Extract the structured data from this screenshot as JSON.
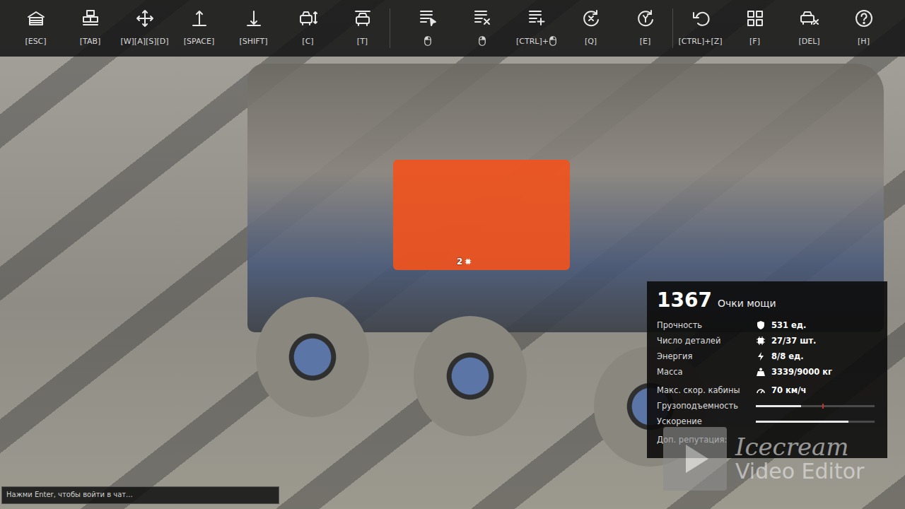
{
  "toolbar": {
    "items": [
      {
        "key": "[ESC]",
        "kind": "key"
      },
      {
        "key": "[TAB]",
        "kind": "key"
      },
      {
        "key": "[W][A][S][D]",
        "kind": "key"
      },
      {
        "key": "[SPACE]",
        "kind": "key"
      },
      {
        "key": "[SHIFT]",
        "kind": "key"
      },
      {
        "key": "[C]",
        "kind": "key"
      },
      {
        "key": "[T]",
        "kind": "key"
      },
      {
        "kind": "mouse",
        "button": "left"
      },
      {
        "kind": "mouse",
        "button": "right"
      },
      {
        "key": "[CTRL]+",
        "kind": "key-mouse",
        "button": "left"
      },
      {
        "key": "[Q]",
        "kind": "key"
      },
      {
        "key": "[E]",
        "kind": "key"
      },
      {
        "key": "[CTRL]+[Z]",
        "kind": "key"
      },
      {
        "key": "[F]",
        "kind": "key"
      },
      {
        "key": "[DEL]",
        "kind": "key"
      },
      {
        "key": "[H]",
        "kind": "key"
      }
    ]
  },
  "scene": {
    "part_count": "2"
  },
  "stats": {
    "power": "1367",
    "power_label": "Очки мощи",
    "rows": [
      {
        "label": "Прочность",
        "kind": "value",
        "value": "531 ед."
      },
      {
        "label": "Число деталей",
        "kind": "value",
        "value": "27/37 шт."
      },
      {
        "label": "Энергия",
        "kind": "value",
        "value": "8/8 ед."
      },
      {
        "label": "Масса",
        "kind": "value",
        "value": "3339/9000 кг"
      },
      {
        "label": "Макс. скор. кабины",
        "kind": "value",
        "value": "70 км/ч"
      },
      {
        "label": "Грузоподъемность",
        "kind": "bar",
        "level": 0.38,
        "marker": 0.56
      },
      {
        "label": "Ускорение",
        "kind": "bar",
        "level": 0.78,
        "marker": null
      },
      {
        "label": "Доп. репутация:",
        "kind": "label"
      }
    ]
  },
  "chat": {
    "placeholder": "Нажми Enter, чтобы войти в чат..."
  },
  "watermark": {
    "line1": "Icecream",
    "line2": "Video Editor"
  }
}
